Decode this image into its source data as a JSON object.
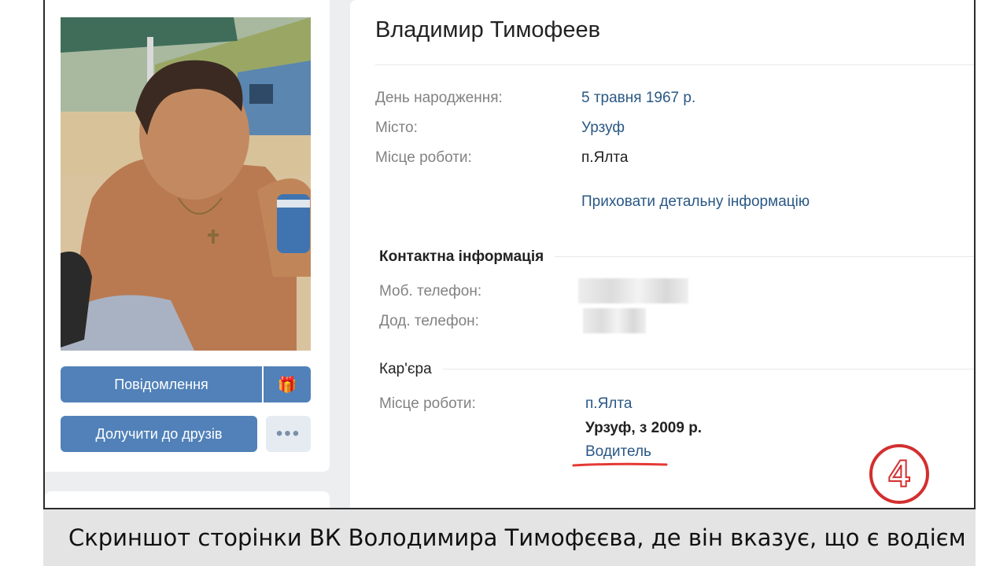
{
  "profile": {
    "name": "Владимир Тимофеев",
    "buttons": {
      "message": "Повідомлення",
      "add_friend": "Долучити до друзів",
      "more": "•••",
      "gift_icon": "gift-icon"
    },
    "info": [
      {
        "label": "День народження:",
        "value": "5 травня 1967 р."
      },
      {
        "label": "Місто:",
        "value": "Урзуф"
      },
      {
        "label": "Місце роботи:",
        "value": "п.Ялта"
      }
    ],
    "hide_details": "Приховати детальну інформацію",
    "contact": {
      "title": "Контактна інформація",
      "mobile_label": "Моб. телефон:",
      "extra_label": "Дод. телефон:"
    },
    "career": {
      "title": "Кар'єра",
      "label": "Місце роботи:",
      "company": "п.Ялта",
      "location_years": "Урзуф, з 2009 р.",
      "position": "Водитель"
    }
  },
  "watermark": "4",
  "caption": "Скриншот сторінки ВК Володимира Тимофєєва, де він вказує, що є водієм",
  "colors": {
    "accent": "#5181b8",
    "link": "#2a5885",
    "highlight_red": "#e53935"
  }
}
